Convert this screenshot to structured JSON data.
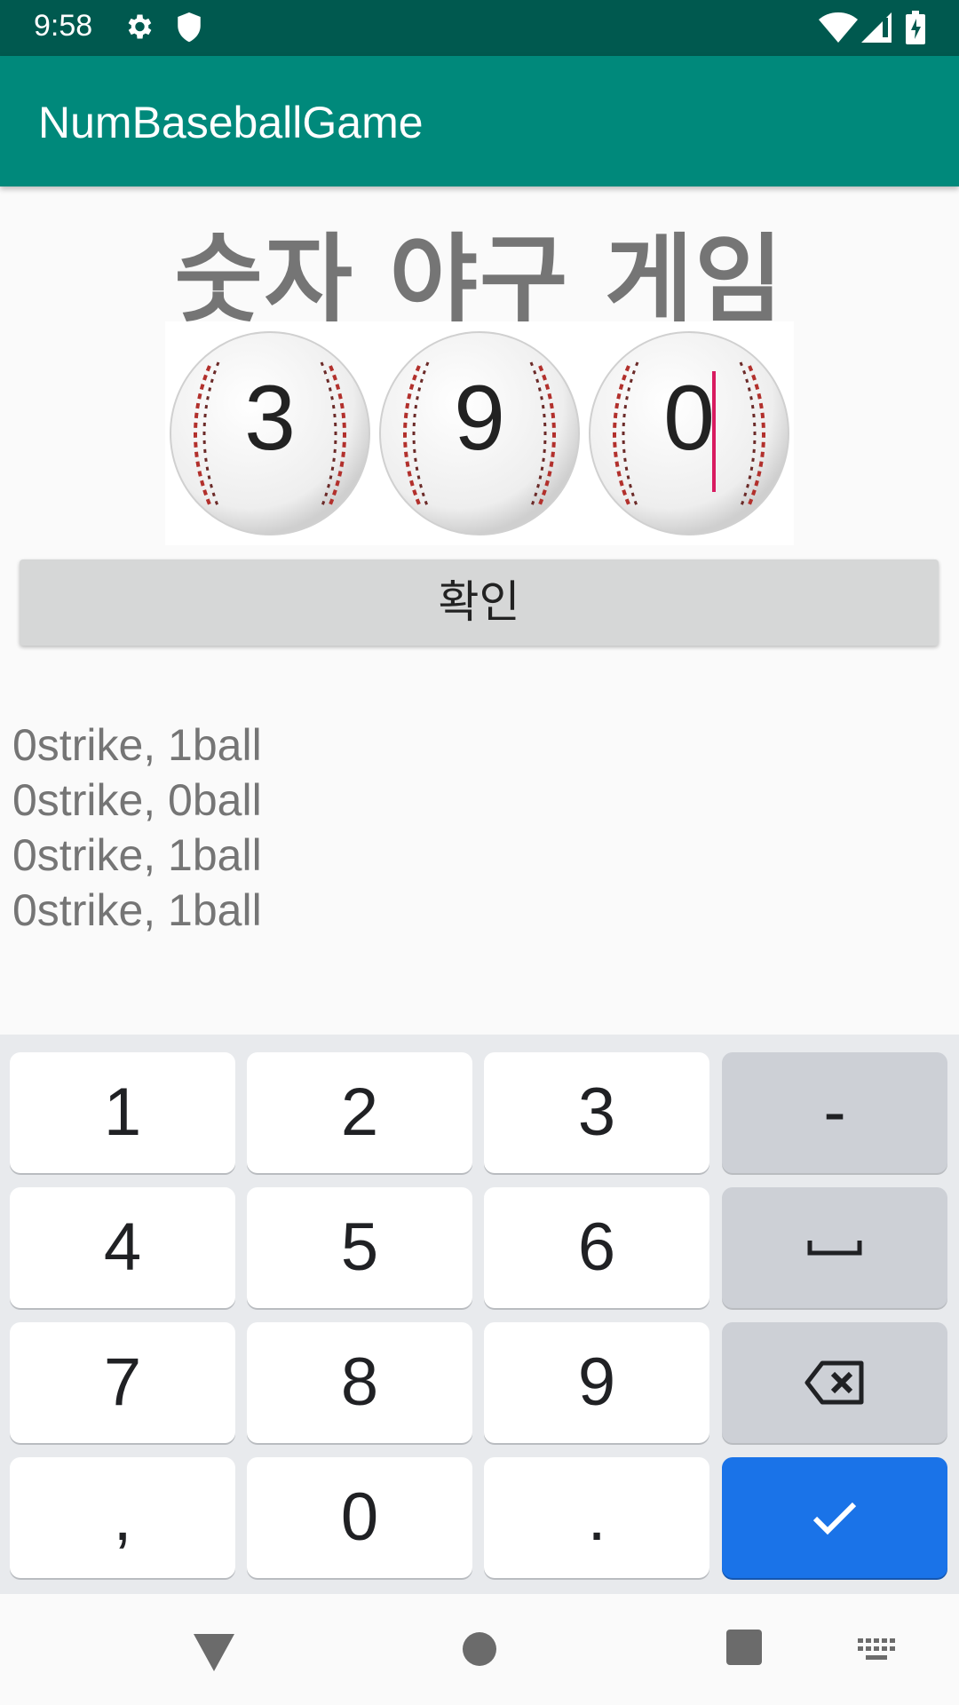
{
  "status_bar": {
    "time": "9:58"
  },
  "app_bar": {
    "title": "NumBaseballGame"
  },
  "game": {
    "title": "숫자 야구 게임",
    "digits": [
      "3",
      "9",
      "0"
    ],
    "confirm_label": "확인",
    "results": [
      "0strike, 1ball",
      "0strike, 0ball",
      "0strike, 1ball",
      "0strike, 1ball"
    ]
  },
  "keyboard": {
    "rows": [
      [
        "1",
        "2",
        "3",
        "-"
      ],
      [
        "4",
        "5",
        "6",
        "space"
      ],
      [
        "7",
        "8",
        "9",
        "backspace"
      ],
      [
        ",",
        "0",
        ".",
        "done"
      ]
    ],
    "accent_color": "#1a73e8"
  },
  "colors": {
    "status_bar": "#00594f",
    "app_bar": "#00897b",
    "cursor": "#d81b60"
  }
}
